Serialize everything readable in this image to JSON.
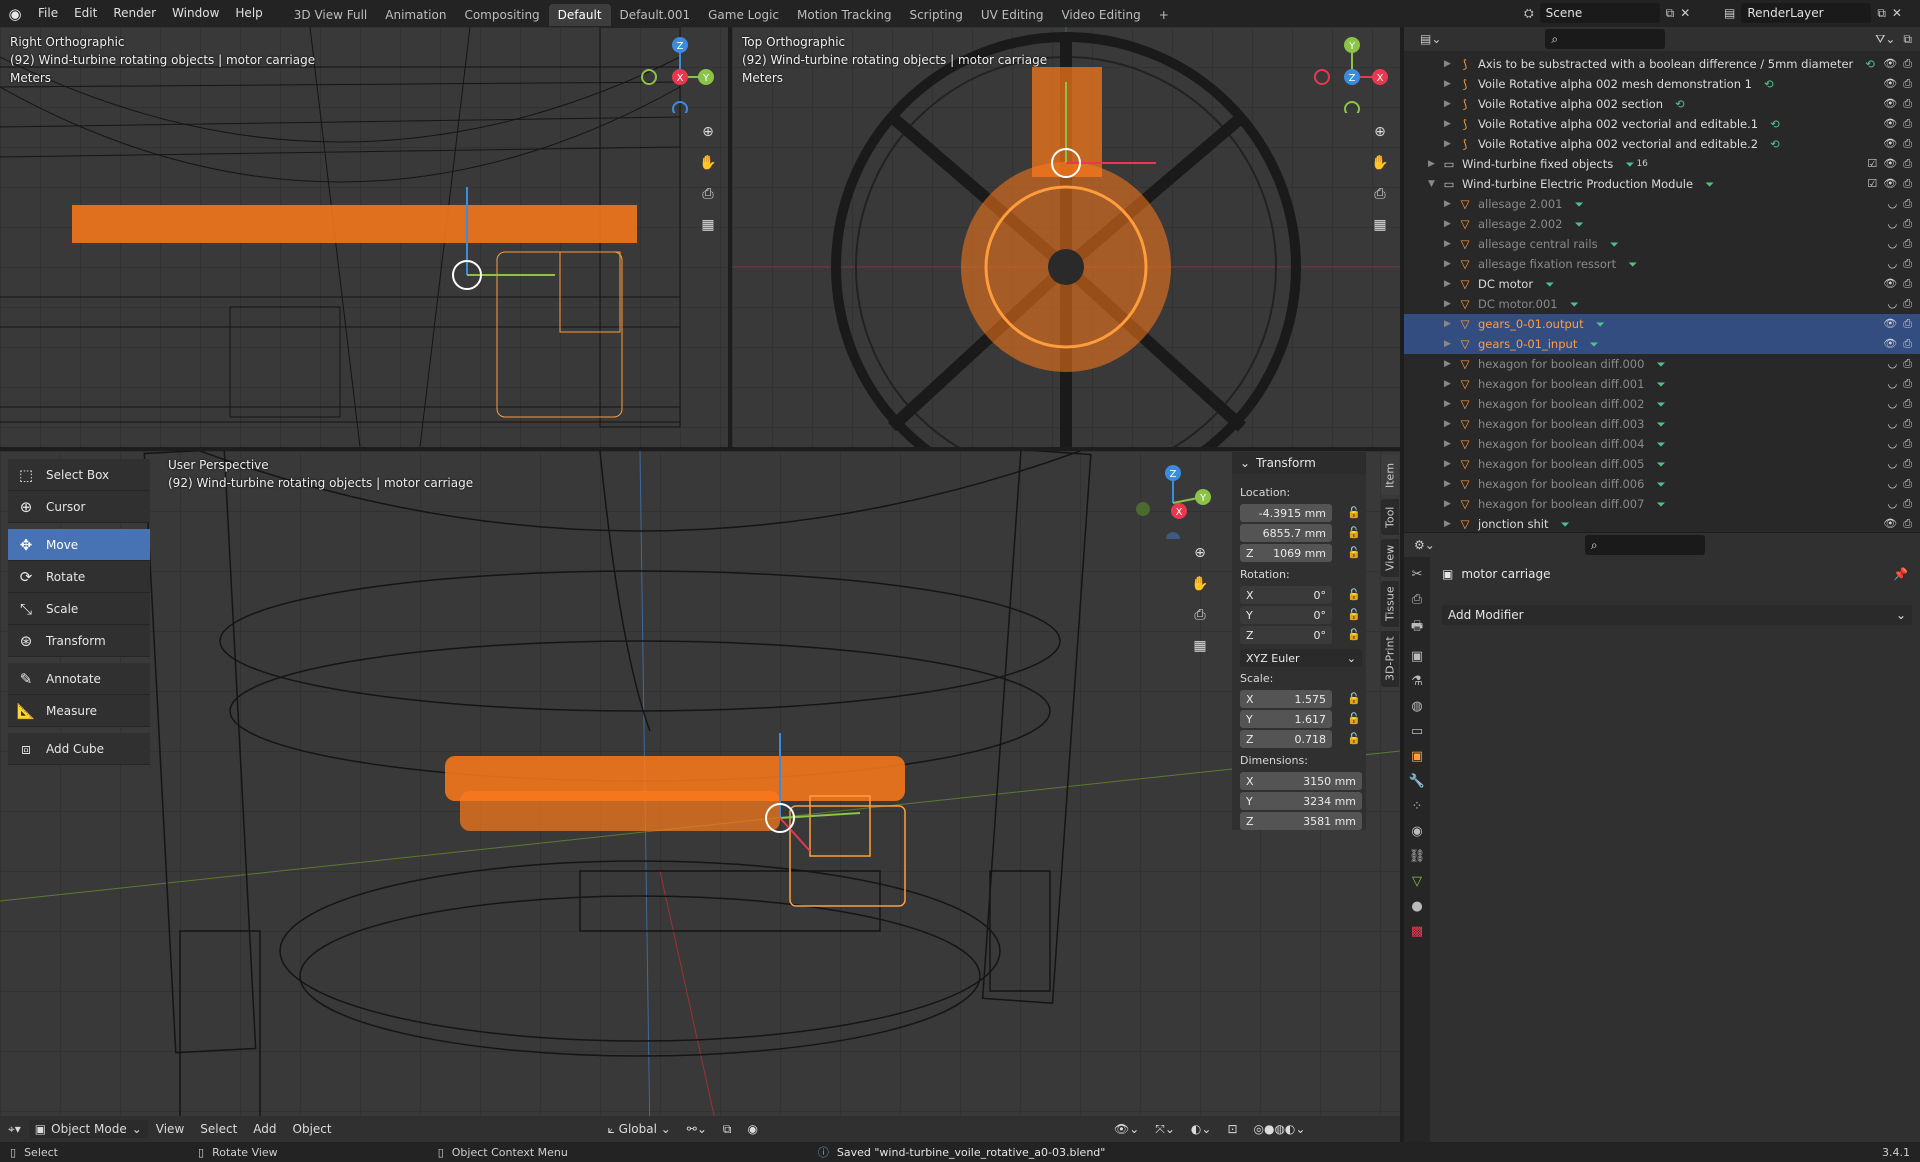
{
  "topbar": {
    "menus": [
      "File",
      "Edit",
      "Render",
      "Window",
      "Help"
    ],
    "workspaces": [
      "3D View Full",
      "Animation",
      "Compositing",
      "Default",
      "Default.001",
      "Game Logic",
      "Motion Tracking",
      "Scripting",
      "UV Editing",
      "Video Editing"
    ],
    "active_workspace": "Default",
    "add_tab": "+",
    "scene": "Scene",
    "view_layer": "RenderLayer"
  },
  "vp_right": {
    "title": "Right Orthographic",
    "collection": "(92) Wind-turbine rotating objects | motor carriage",
    "units": "Meters"
  },
  "vp_top": {
    "title": "Top Orthographic",
    "collection": "(92) Wind-turbine rotating objects | motor carriage",
    "units": "Meters"
  },
  "vp_persp": {
    "title": "User Perspective",
    "collection": "(92) Wind-turbine rotating objects | motor carriage"
  },
  "header": {
    "mode": "Object Mode",
    "view": "View",
    "select": "Select",
    "add": "Add",
    "object": "Object",
    "orientation": "Global"
  },
  "gizmo": {
    "x": "X",
    "y": "Y",
    "z": "Z"
  },
  "tools": [
    "Select Box",
    "Cursor",
    "Move",
    "Rotate",
    "Scale",
    "Transform",
    "Annotate",
    "Measure",
    "Add Cube"
  ],
  "active_tool": "Move",
  "transform": {
    "title": "Transform",
    "location_label": "Location:",
    "location": [
      "-4.3915 mm",
      "6855.7 mm",
      "1069 mm"
    ],
    "rotation_label": "Rotation:",
    "rotation": [
      "0°",
      "0°",
      "0°"
    ],
    "rotation_mode": "XYZ Euler",
    "scale_label": "Scale:",
    "scale": [
      "1.575",
      "1.617",
      "0.718"
    ],
    "dimensions_label": "Dimensions:",
    "dimensions": [
      "3150 mm",
      "3234 mm",
      "3581 mm"
    ]
  },
  "side_tabs": [
    "Item",
    "Tool",
    "View",
    "Tissue",
    "3D-Print"
  ],
  "outliner": {
    "rows": [
      {
        "name": "Axis to be substracted with a boolean difference / 5mm diameter",
        "icon": "curve"
      },
      {
        "name": "Voile Rotative alpha 002 mesh demonstration 1",
        "icon": "curve"
      },
      {
        "name": "Voile Rotative alpha 002 section",
        "icon": "curve"
      },
      {
        "name": "Voile Rotative alpha 002 vectorial and editable.1",
        "icon": "curve"
      },
      {
        "name": "Voile Rotative alpha 002 vectorial and editable.2",
        "icon": "curve"
      },
      {
        "name": "Wind-turbine fixed objects",
        "icon": "collection",
        "badge": "16"
      },
      {
        "name": "Wind-turbine Electric Production Module",
        "icon": "collection"
      },
      {
        "name": "allesage 2.001",
        "icon": "mesh",
        "dim": true
      },
      {
        "name": "allesage 2.002",
        "icon": "mesh",
        "dim": true
      },
      {
        "name": "allesage central rails",
        "icon": "mesh",
        "dim": true
      },
      {
        "name": "allesage fixation ressort",
        "icon": "mesh",
        "dim": true
      },
      {
        "name": "DC motor",
        "icon": "mesh"
      },
      {
        "name": "DC motor.001",
        "icon": "mesh",
        "dim": true
      },
      {
        "name": "gears_0-01.output",
        "icon": "mesh",
        "selected": true
      },
      {
        "name": "gears_0-01_input",
        "icon": "mesh",
        "selected": true
      },
      {
        "name": "hexagon for boolean diff.000",
        "icon": "mesh",
        "dim": true
      },
      {
        "name": "hexagon for boolean diff.001",
        "icon": "mesh",
        "dim": true
      },
      {
        "name": "hexagon for boolean diff.002",
        "icon": "mesh",
        "dim": true
      },
      {
        "name": "hexagon for boolean diff.003",
        "icon": "mesh",
        "dim": true
      },
      {
        "name": "hexagon for boolean diff.004",
        "icon": "mesh",
        "dim": true
      },
      {
        "name": "hexagon for boolean diff.005",
        "icon": "mesh",
        "dim": true
      },
      {
        "name": "hexagon for boolean diff.006",
        "icon": "mesh",
        "dim": true
      },
      {
        "name": "hexagon for boolean diff.007",
        "icon": "mesh",
        "dim": true
      },
      {
        "name": "jonction shit",
        "icon": "mesh"
      }
    ]
  },
  "properties": {
    "object_name": "motor carriage",
    "add_modifier": "Add Modifier"
  },
  "status": {
    "select": "Select",
    "rotate_view": "Rotate View",
    "context_menu": "Object Context Menu",
    "message": "Saved \"wind-turbine_voile_rotative_a0-03.blend\"",
    "version": "3.4.1"
  },
  "colors": {
    "accent": "#4772b3",
    "selection": "#ff8c1a",
    "x_axis": "#e8384f",
    "y_axis": "#8ac346",
    "z_axis": "#3d8be0"
  }
}
